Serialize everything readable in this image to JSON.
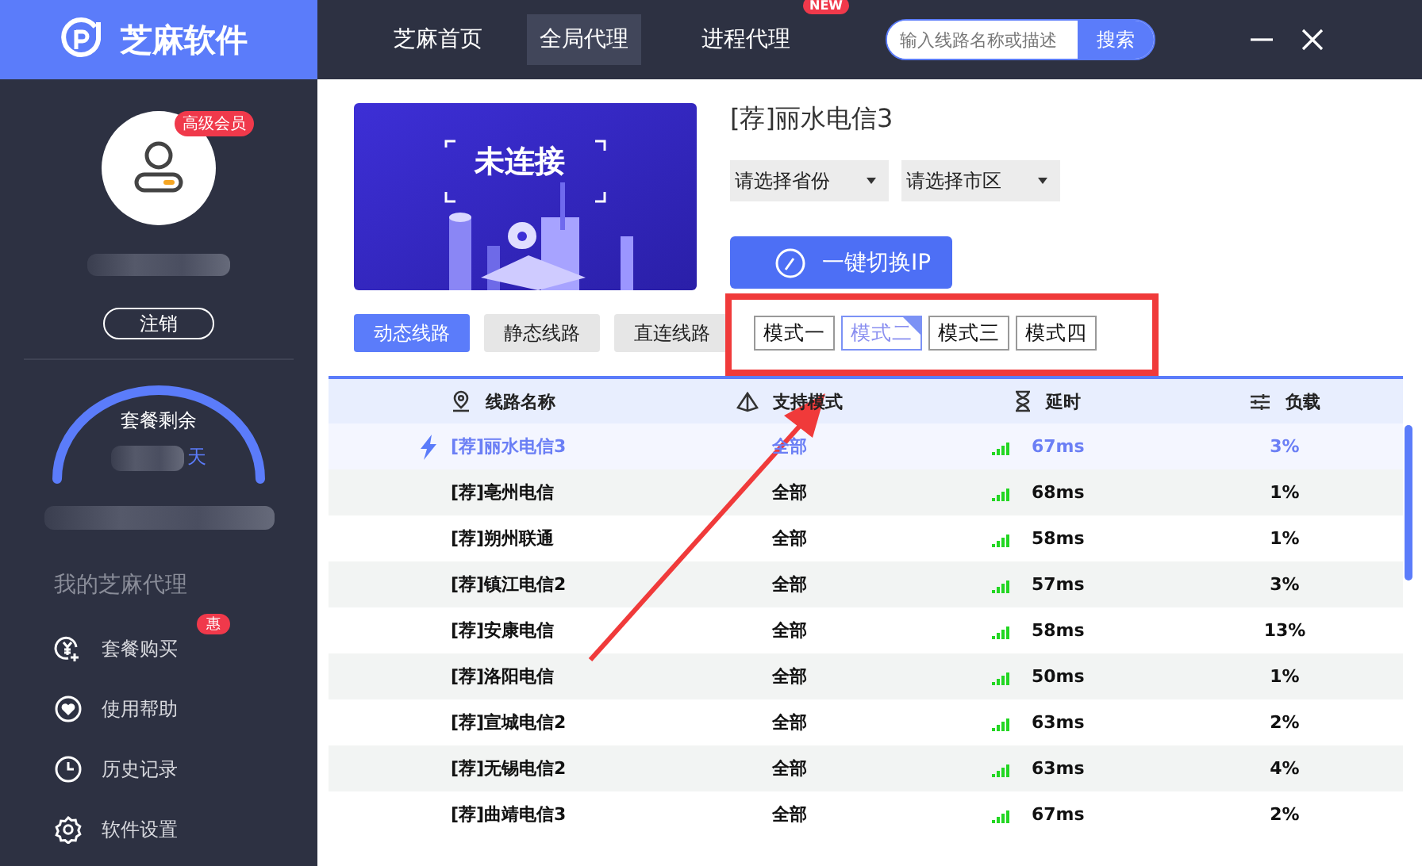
{
  "app": {
    "title": "芝麻软件"
  },
  "nav": [
    {
      "label": "芝麻首页",
      "selected": false
    },
    {
      "label": "全局代理",
      "selected": true
    },
    {
      "label": "进程代理",
      "selected": false,
      "badge": "NEW"
    }
  ],
  "search": {
    "placeholder": "输入线路名称或描述",
    "button": "搜索"
  },
  "user": {
    "badge": "高级会员",
    "logout": "注销"
  },
  "plan": {
    "label": "套餐剩余",
    "unit": "天"
  },
  "menu": {
    "title": "我的芝麻代理",
    "items": [
      {
        "kind": "buy",
        "label": "套餐购买",
        "badge": "惠"
      },
      {
        "kind": "help",
        "label": "使用帮助"
      },
      {
        "kind": "history",
        "label": "历史记录"
      },
      {
        "kind": "settings",
        "label": "软件设置"
      }
    ]
  },
  "status": "未连接",
  "current_line": "[荐]丽水电信3",
  "selects": [
    {
      "placeholder": "请选择省份"
    },
    {
      "placeholder": "请选择市区"
    }
  ],
  "switch_button": "一键切换IP",
  "line_tabs": [
    {
      "label": "动态线路",
      "selected": true
    },
    {
      "label": "静态线路",
      "selected": false
    },
    {
      "label": "直连线路",
      "selected": false
    }
  ],
  "modes": [
    {
      "label": "模式一",
      "selected": false
    },
    {
      "label": "模式二",
      "selected": true
    },
    {
      "label": "模式三",
      "selected": false
    },
    {
      "label": "模式四",
      "selected": false
    }
  ],
  "table": {
    "columns": [
      {
        "kind": "location",
        "label": "线路名称"
      },
      {
        "kind": "mode",
        "label": "支持模式"
      },
      {
        "kind": "time",
        "label": "延时"
      },
      {
        "kind": "load",
        "label": "负载"
      }
    ],
    "rows": [
      {
        "name": "[荐]丽水电信3",
        "mode": "全部",
        "latency": "67ms",
        "load": "3%",
        "selected": true
      },
      {
        "name": "[荐]亳州电信",
        "mode": "全部",
        "latency": "68ms",
        "load": "1%",
        "selected": false
      },
      {
        "name": "[荐]朔州联通",
        "mode": "全部",
        "latency": "58ms",
        "load": "1%",
        "selected": false
      },
      {
        "name": "[荐]镇江电信2",
        "mode": "全部",
        "latency": "57ms",
        "load": "3%",
        "selected": false
      },
      {
        "name": "[荐]安康电信",
        "mode": "全部",
        "latency": "58ms",
        "load": "13%",
        "selected": false
      },
      {
        "name": "[荐]洛阳电信",
        "mode": "全部",
        "latency": "50ms",
        "load": "1%",
        "selected": false
      },
      {
        "name": "[荐]宣城电信2",
        "mode": "全部",
        "latency": "63ms",
        "load": "2%",
        "selected": false
      },
      {
        "name": "[荐]无锡电信2",
        "mode": "全部",
        "latency": "63ms",
        "load": "4%",
        "selected": false
      },
      {
        "name": "[荐]曲靖电信3",
        "mode": "全部",
        "latency": "67ms",
        "load": "2%",
        "selected": false
      }
    ]
  }
}
